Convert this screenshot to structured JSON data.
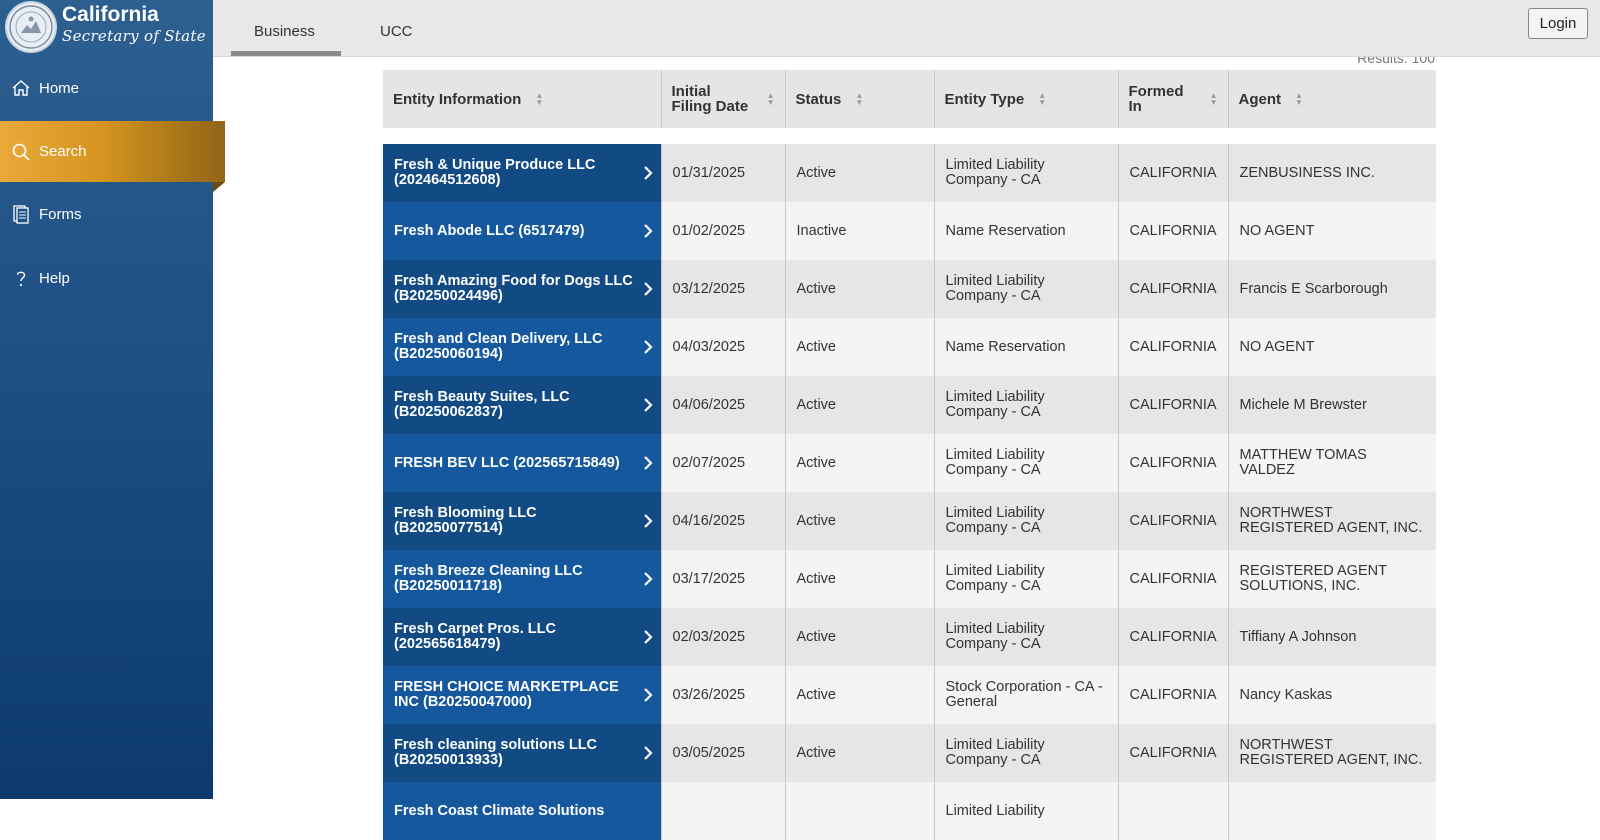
{
  "brand": {
    "title": "California",
    "subtitle": "Secretary of State"
  },
  "sidebar": {
    "items": [
      {
        "label": "Home",
        "icon": "home-icon"
      },
      {
        "label": "Search",
        "icon": "search-icon",
        "active": true
      },
      {
        "label": "Forms",
        "icon": "forms-icon"
      },
      {
        "label": "Help",
        "icon": "help-icon"
      }
    ]
  },
  "tabs": [
    {
      "label": "Business",
      "active": true
    },
    {
      "label": "UCC"
    }
  ],
  "login_label": "Login",
  "results_text": "Results: 100",
  "table": {
    "headers": [
      "Entity Information",
      "Initial Filing Date",
      "Status",
      "Entity Type",
      "Formed In",
      "Agent"
    ],
    "rows": [
      {
        "entity": "Fresh & Unique Produce LLC (202464512608)",
        "date": "01/31/2025",
        "status": "Active",
        "type": "Limited Liability Company - CA",
        "formed": "CALIFORNIA",
        "agent": "ZENBUSINESS INC."
      },
      {
        "entity": "Fresh Abode LLC (6517479)",
        "date": "01/02/2025",
        "status": "Inactive",
        "type": "Name Reservation",
        "formed": "CALIFORNIA",
        "agent": "NO AGENT"
      },
      {
        "entity": "Fresh Amazing Food for Dogs LLC (B20250024496)",
        "date": "03/12/2025",
        "status": "Active",
        "type": "Limited Liability Company - CA",
        "formed": "CALIFORNIA",
        "agent": "Francis E Scarborough"
      },
      {
        "entity": "Fresh and Clean Delivery, LLC (B20250060194)",
        "date": "04/03/2025",
        "status": "Active",
        "type": "Name Reservation",
        "formed": "CALIFORNIA",
        "agent": "NO AGENT"
      },
      {
        "entity": "Fresh Beauty Suites, LLC (B20250062837)",
        "date": "04/06/2025",
        "status": "Active",
        "type": "Limited Liability Company - CA",
        "formed": "CALIFORNIA",
        "agent": "Michele M Brewster"
      },
      {
        "entity": "FRESH BEV LLC (202565715849)",
        "date": "02/07/2025",
        "status": "Active",
        "type": "Limited Liability Company - CA",
        "formed": "CALIFORNIA",
        "agent": "MATTHEW TOMAS VALDEZ"
      },
      {
        "entity": "Fresh Blooming LLC (B20250077514)",
        "date": "04/16/2025",
        "status": "Active",
        "type": "Limited Liability Company - CA",
        "formed": "CALIFORNIA",
        "agent": "NORTHWEST REGISTERED AGENT, INC."
      },
      {
        "entity": "Fresh Breeze Cleaning LLC (B20250011718)",
        "date": "03/17/2025",
        "status": "Active",
        "type": "Limited Liability Company - CA",
        "formed": "CALIFORNIA",
        "agent": "REGISTERED AGENT SOLUTIONS, INC."
      },
      {
        "entity": "Fresh Carpet Pros. LLC (202565618479)",
        "date": "02/03/2025",
        "status": "Active",
        "type": "Limited Liability Company - CA",
        "formed": "CALIFORNIA",
        "agent": "Tiffiany A Johnson"
      },
      {
        "entity": "FRESH CHOICE MARKETPLACE INC (B20250047000)",
        "date": "03/26/2025",
        "status": "Active",
        "type": "Stock Corporation - CA - General",
        "formed": "CALIFORNIA",
        "agent": "Nancy Kaskas"
      },
      {
        "entity": "Fresh cleaning solutions  LLC (B20250013933)",
        "date": "03/05/2025",
        "status": "Active",
        "type": "Limited Liability Company - CA",
        "formed": "CALIFORNIA",
        "agent": "NORTHWEST REGISTERED AGENT, INC."
      },
      {
        "entity": "Fresh Coast Climate Solutions",
        "date": "",
        "status": "",
        "type": "Limited Liability",
        "formed": "",
        "agent": ""
      }
    ]
  },
  "colors": {
    "sidebar": "#1e4f85",
    "active_nav": "#e0a030",
    "entity_cell": "#124a84",
    "entity_cell_alt": "#15589d"
  }
}
